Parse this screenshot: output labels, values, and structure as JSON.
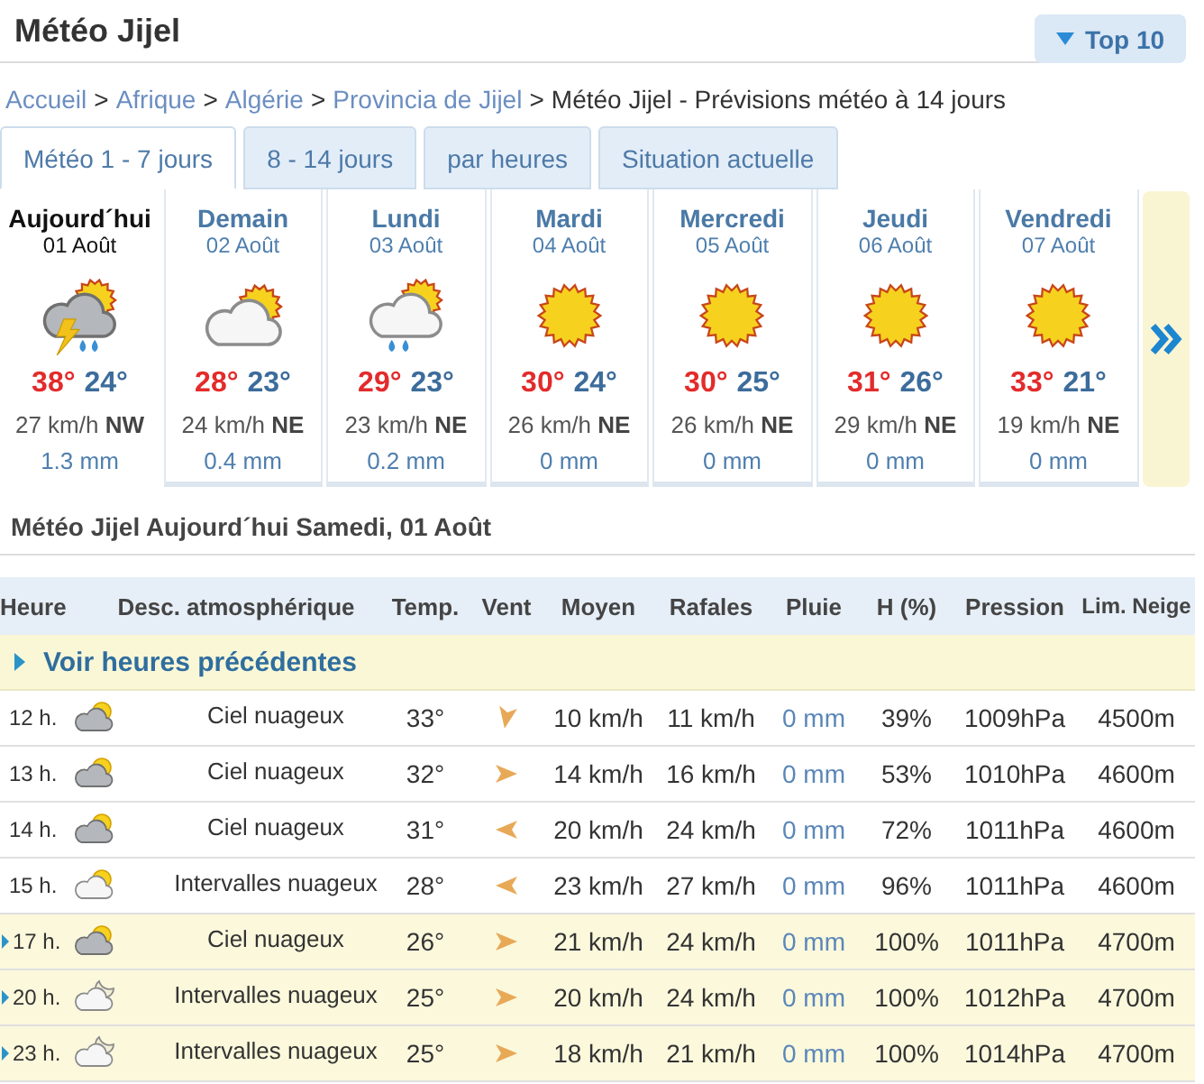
{
  "header": {
    "title": "Météo Jijel",
    "top_button": "Top 10"
  },
  "breadcrumb": [
    {
      "kind": "link",
      "label": "Accueil"
    },
    {
      "kind": "separator",
      "label": ">"
    },
    {
      "kind": "link",
      "label": "Afrique"
    },
    {
      "kind": "separator",
      "label": ">"
    },
    {
      "kind": "link",
      "label": "Algérie"
    },
    {
      "kind": "separator",
      "label": ">"
    },
    {
      "kind": "link",
      "label": "Provincia de Jijel"
    },
    {
      "kind": "separator",
      "label": ">"
    },
    {
      "kind": "current",
      "label": "Météo Jijel - Prévisions météo à 14 jours"
    }
  ],
  "tabs": [
    {
      "label": "Météo 1 - 7 jours",
      "selected": true
    },
    {
      "label": "8 - 14 jours",
      "selected": false
    },
    {
      "label": "par heures",
      "selected": false
    },
    {
      "label": "Situation actuelle",
      "selected": false
    }
  ],
  "days": [
    {
      "kind": "storm",
      "name": "Aujourd´hui",
      "date": "01 Août",
      "max": "38°",
      "min": "24°",
      "wind": "27 km/h **NW**",
      "rain": "1.3 mm",
      "selected": true
    },
    {
      "kind": "cloudy",
      "name": "Demain",
      "date": "02 Août",
      "max": "28°",
      "min": "23°",
      "wind": "24 km/h **NE**",
      "rain": "0.4 mm",
      "selected": false
    },
    {
      "kind": "showers",
      "name": "Lundi",
      "date": "03 Août",
      "max": "29°",
      "min": "23°",
      "wind": "23 km/h **NE**",
      "rain": "0.2 mm",
      "selected": false
    },
    {
      "kind": "sunny",
      "name": "Mardi",
      "date": "04 Août",
      "max": "30°",
      "min": "24°",
      "wind": "26 km/h **NE**",
      "rain": "0 mm",
      "selected": false
    },
    {
      "kind": "sunny",
      "name": "Mercredi",
      "date": "05 Août",
      "max": "30°",
      "min": "25°",
      "wind": "26 km/h **NE**",
      "rain": "0 mm",
      "selected": false
    },
    {
      "kind": "sunny",
      "name": "Jeudi",
      "date": "06 Août",
      "max": "31°",
      "min": "26°",
      "wind": "29 km/h **NE**",
      "rain": "0 mm",
      "selected": false
    },
    {
      "kind": "sunny",
      "name": "Vendredi",
      "date": "07 Août",
      "max": "33°",
      "min": "21°",
      "wind": "19 km/h **NE**",
      "rain": "0 mm",
      "selected": false
    }
  ],
  "section_title": "Météo Jijel Aujourd´hui Samedi, 01 Août",
  "table": {
    "columns": [
      "Heure",
      "Desc. atmosphérique",
      "Temp.",
      "Vent",
      "Moyen",
      "Rafales",
      "Pluie",
      "H (%)",
      "Pression",
      "Lim. Neige"
    ],
    "previous_link": "Voir heures précédentes",
    "rows": [
      {
        "kind": "cloudy",
        "hour": "12 h.",
        "desc": "Ciel nuageux",
        "temp": "33°",
        "wind": {
          "kind": "south",
          "mean": "10 km/h",
          "gusts": "11 km/h"
        },
        "rain": "0 mm",
        "humidity": "39%",
        "pressure": "1009hPa",
        "snow_limit": "4500m",
        "expandable": false
      },
      {
        "kind": "cloudy",
        "hour": "13 h.",
        "desc": "Ciel nuageux",
        "temp": "32°",
        "wind": {
          "kind": "east",
          "mean": "14 km/h",
          "gusts": "16 km/h"
        },
        "rain": "0 mm",
        "humidity": "53%",
        "pressure": "1010hPa",
        "snow_limit": "4600m",
        "expandable": false
      },
      {
        "kind": "cloudy",
        "hour": "14 h.",
        "desc": "Ciel nuageux",
        "temp": "31°",
        "wind": {
          "kind": "west",
          "mean": "20 km/h",
          "gusts": "24 km/h"
        },
        "rain": "0 mm",
        "humidity": "72%",
        "pressure": "1011hPa",
        "snow_limit": "4600m",
        "expandable": false
      },
      {
        "kind": "partly",
        "hour": "15 h.",
        "desc": "Intervalles nuageux",
        "temp": "28°",
        "wind": {
          "kind": "west",
          "mean": "23 km/h",
          "gusts": "27 km/h"
        },
        "rain": "0 mm",
        "humidity": "96%",
        "pressure": "1011hPa",
        "snow_limit": "4600m",
        "expandable": false
      },
      {
        "kind": "cloudy",
        "hour": "17 h.",
        "desc": "Ciel nuageux",
        "temp": "26°",
        "wind": {
          "kind": "east",
          "mean": "21 km/h",
          "gusts": "24 km/h"
        },
        "rain": "0 mm",
        "humidity": "100%",
        "pressure": "1011hPa",
        "snow_limit": "4700m",
        "expandable": true
      },
      {
        "kind": "night",
        "hour": "20 h.",
        "desc": "Intervalles nuageux",
        "temp": "25°",
        "wind": {
          "kind": "east",
          "mean": "20 km/h",
          "gusts": "24 km/h"
        },
        "rain": "0 mm",
        "humidity": "100%",
        "pressure": "1012hPa",
        "snow_limit": "4700m",
        "expandable": true
      },
      {
        "kind": "night",
        "hour": "23 h.",
        "desc": "Intervalles nuageux",
        "temp": "25°",
        "wind": {
          "kind": "east",
          "mean": "18 km/h",
          "gusts": "21 km/h"
        },
        "rain": "0 mm",
        "humidity": "100%",
        "pressure": "1014hPa",
        "snow_limit": "4700m",
        "expandable": true
      }
    ]
  }
}
